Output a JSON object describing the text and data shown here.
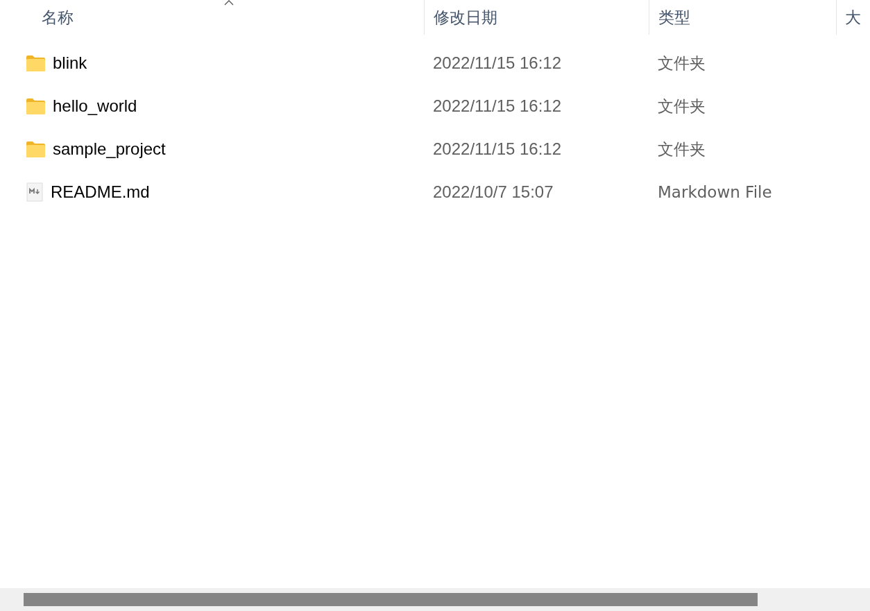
{
  "columns": [
    {
      "label": "名称",
      "sorted": true
    },
    {
      "label": "修改日期",
      "sorted": false
    },
    {
      "label": "类型",
      "sorted": false
    },
    {
      "label": "大",
      "sorted": false
    }
  ],
  "rows": [
    {
      "kind": "folder",
      "name": "blink",
      "modified": "2022/11/15 16:12",
      "type": "文件夹"
    },
    {
      "kind": "folder",
      "name": "hello_world",
      "modified": "2022/11/15 16:12",
      "type": "文件夹"
    },
    {
      "kind": "folder",
      "name": "sample_project",
      "modified": "2022/11/15 16:12",
      "type": "文件夹"
    },
    {
      "kind": "markdown",
      "name": "README.md",
      "modified": "2022/10/7 15:07",
      "type": "Markdown File"
    }
  ]
}
